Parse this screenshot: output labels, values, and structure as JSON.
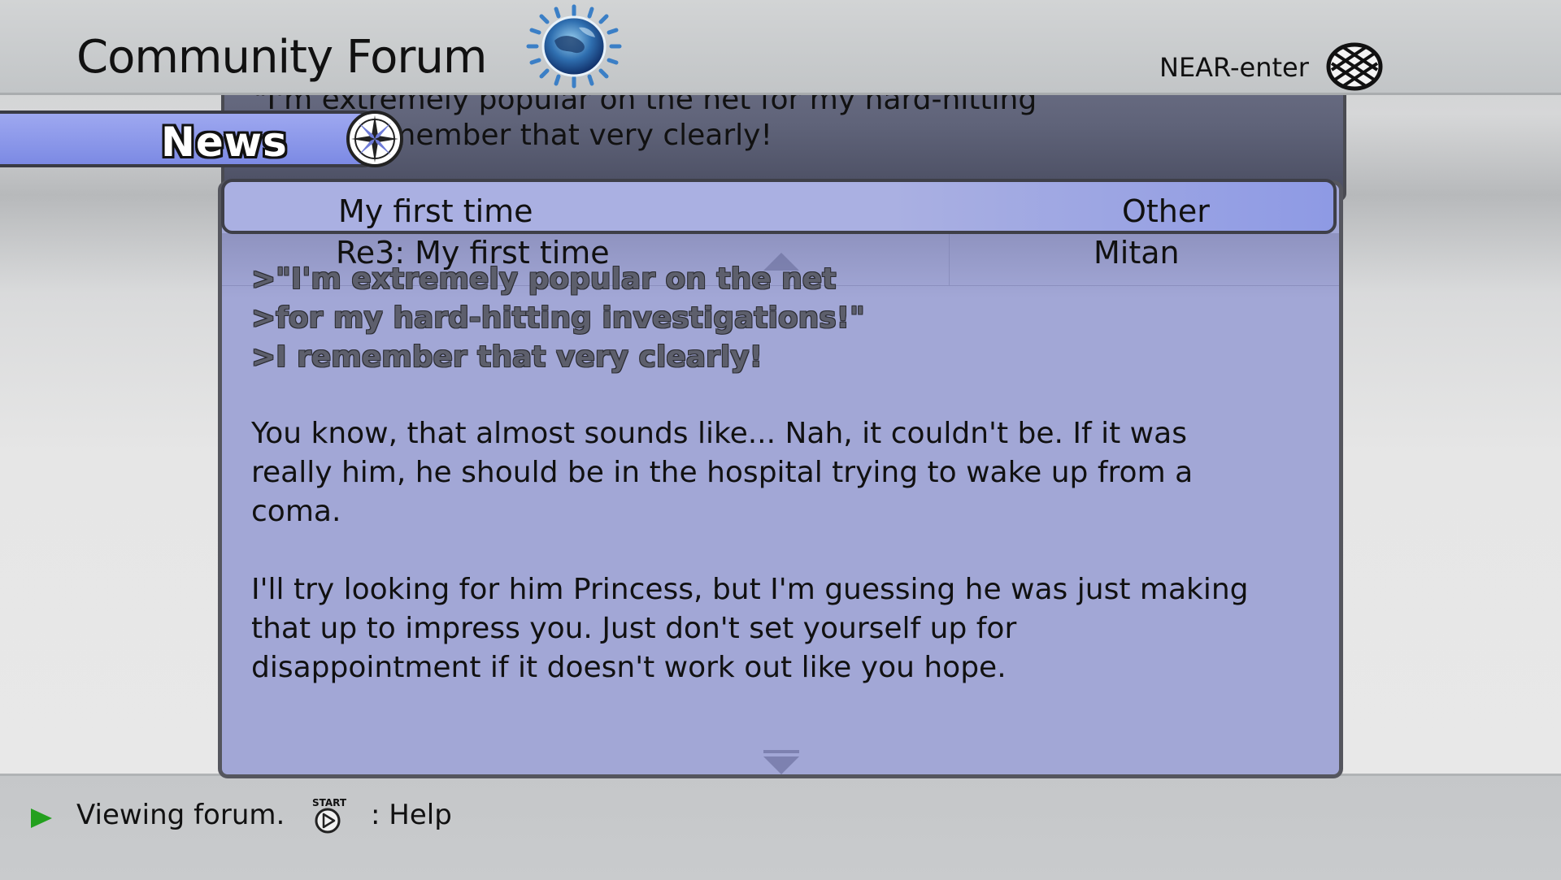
{
  "header": {
    "title": "Community Forum",
    "network_label": "NEAR-enter",
    "logo_icon": "globe-logo-icon",
    "network_icon": "net-globe-icon"
  },
  "section_tab": {
    "label": "News",
    "icon": "compass-icon",
    "color": "#8c98ea"
  },
  "previous_post": {
    "line1": "\"I'm extremely popular on the net for my hard-hitting",
    "line2": "ons!\" I remember that very clearly!"
  },
  "thread": {
    "title": "My first time",
    "category": "Other"
  },
  "reply": {
    "title": "Re3: My first time",
    "author": "Mitan"
  },
  "post_body": {
    "quote_lines": [
      ">\"I'm extremely popular on the net",
      ">for my hard-hitting investigations!\"",
      ">I remember that very clearly!"
    ],
    "paragraph1_lines": [
      "You know, that almost sounds like... Nah, it couldn't be. If it was",
      "really him, he should be in the hospital trying to wake up from a",
      "coma."
    ],
    "paragraph2_lines": [
      "I'll try looking for him Princess, but I'm guessing he was just making",
      "that up to impress you. Just don't set yourself up for",
      "disappointment if it doesn't work out like you hope."
    ]
  },
  "footer": {
    "status": "Viewing forum.",
    "help_button_text": "START",
    "help_label": ": Help",
    "status_icon_color": "#23a01e"
  },
  "colors": {
    "panel": "#a2a7d6",
    "selected_row": "#aab0e2",
    "accent": "#8e9ae4"
  }
}
